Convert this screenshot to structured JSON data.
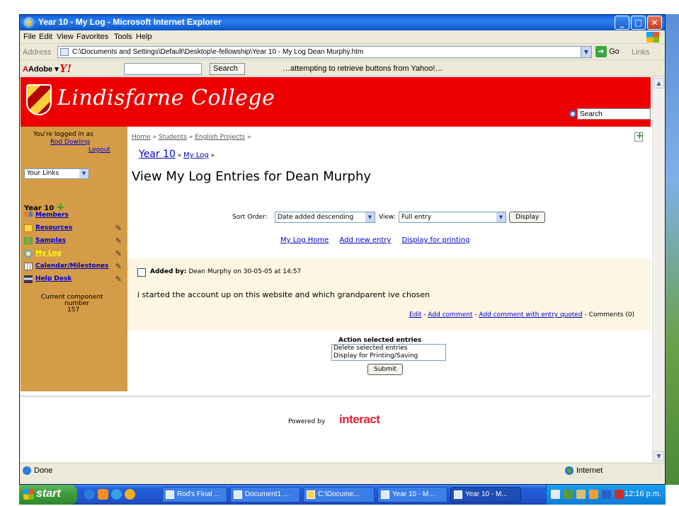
{
  "window": {
    "title": "Year 10 - My Log - Microsoft Internet Explorer",
    "min_btn": "_",
    "max_btn": "□",
    "close_btn": "✕"
  },
  "menubar": {
    "items": [
      "File",
      "Edit",
      "View",
      "Favorites",
      "Tools",
      "Help"
    ]
  },
  "addressbar": {
    "label": "Address",
    "url": "C:\\Documents and Settings\\Default\\Desktop\\e-fellowship\\Year 10 - My Log Dean Murphy.htm",
    "go_label": "Go",
    "links_label": "Links"
  },
  "yahoobar": {
    "adobe_label": "Adobe",
    "search_label": "Search",
    "status": "…attempting to retrieve buttons from Yahoo!…"
  },
  "site": {
    "college_name": "Lindisfarne College",
    "search_placeholder": "Search"
  },
  "sidebar": {
    "logged_in_text": "You're logged in as",
    "user_name": "Rod Dowling",
    "logout_label": "Logout",
    "your_links": "Your Links",
    "group_title": "Year 10",
    "items": [
      {
        "label": "Members",
        "icon": "members-icon"
      },
      {
        "label": "Resources",
        "icon": "folder-icon"
      },
      {
        "label": "Samples",
        "icon": "samples-icon"
      },
      {
        "label": "My Log",
        "icon": "log-icon"
      },
      {
        "label": "Calendar/Milestones",
        "icon": "calendar-icon"
      },
      {
        "label": "Help Desk",
        "icon": "helpdesk-icon"
      }
    ],
    "component_label_1": "Current component",
    "component_label_2": "number",
    "component_number": "157"
  },
  "main": {
    "breadcrumb": [
      "Home",
      "Students",
      "English Projects"
    ],
    "breadcrumb_sep": "»",
    "subnav_year": "Year 10",
    "subnav_log": "My Log",
    "page_title": "View My Log Entries for Dean Murphy",
    "sort_label": "Sort Order:",
    "sort_value": "Date added descending",
    "view_label": "View:",
    "view_value": "Full entry",
    "display_button": "Display",
    "links": [
      "My Log Home",
      "Add new entry",
      "Display for printing"
    ]
  },
  "entry": {
    "added_by_label": "Added by:",
    "added_by_text": "Dean Murphy on 30-05-05 at 14:57",
    "body": "i started the account up on this website and which grandparent ive chosen",
    "edit_link": "Edit",
    "add_comment_link": "Add comment",
    "add_comment_quoted_link": "Add comment with entry quoted",
    "comments_text": "Comments (0)",
    "separator": " - "
  },
  "actions": {
    "title": "Action selected entries",
    "options": [
      "Delete selected entries",
      "Display for Printing/Saving"
    ],
    "submit_label": "Submit"
  },
  "footer": {
    "powered_by": "Powered by",
    "brand": "interact"
  },
  "statusbar": {
    "status": "Done",
    "zone": "Internet"
  },
  "taskbar": {
    "start_label": "start",
    "tasks": [
      "Rod's Final ...",
      "Document1 ...",
      "C:\\Docume...",
      "Year 10 - M...",
      "Year 10 - M..."
    ],
    "clock": "12:16 p.m."
  }
}
